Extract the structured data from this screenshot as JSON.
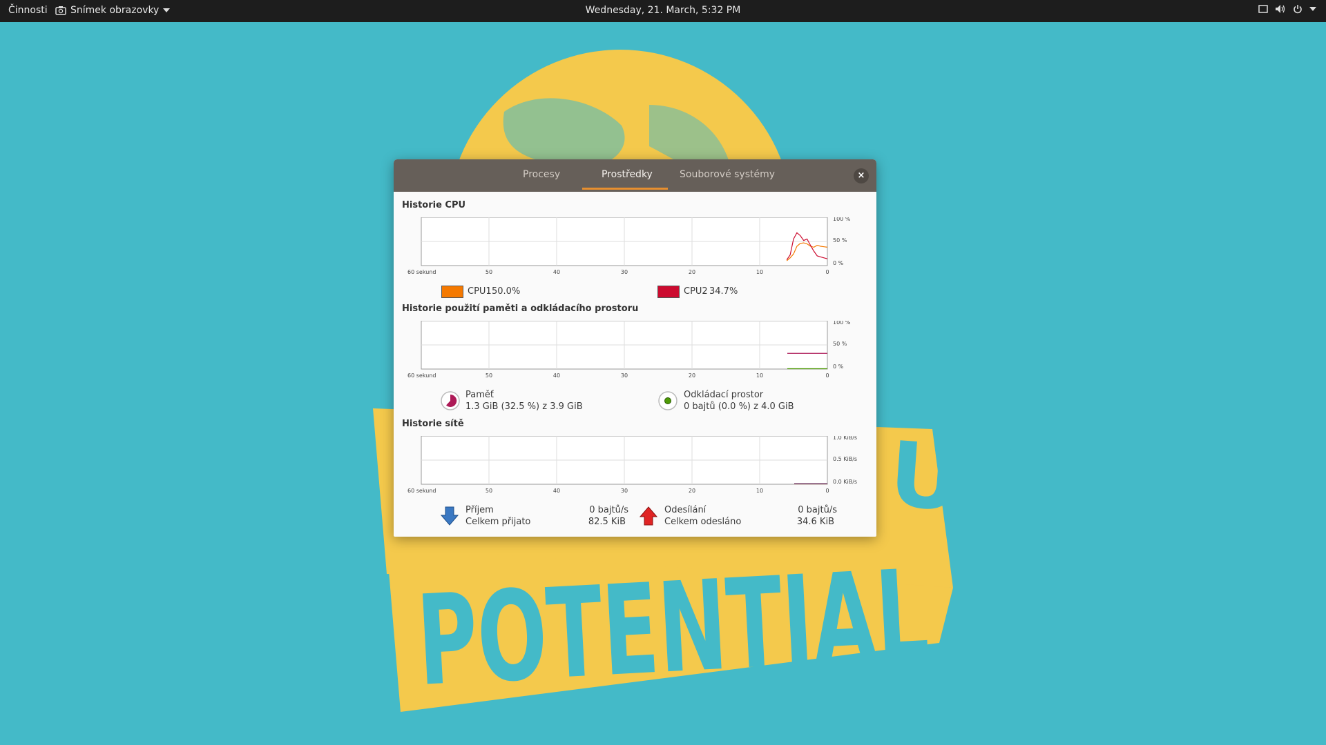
{
  "topbar": {
    "activities": "Činnosti",
    "app_name": "Snímek obrazovky",
    "clock": "Wednesday, 21. March,  5:32 PM",
    "tray_icons": [
      "screen-icon",
      "volume-icon",
      "power-icon",
      "tray-menu-arrow-icon"
    ]
  },
  "window": {
    "tabs": [
      {
        "label": "Procesy",
        "active": false
      },
      {
        "label": "Prostředky",
        "active": true
      },
      {
        "label": "Souborové systémy",
        "active": false
      }
    ],
    "close_label": "×",
    "cpu": {
      "title": "Historie CPU",
      "y_ticks": [
        "100 %",
        "50 %",
        "0 %"
      ],
      "x_ticks": [
        "60 sekund",
        "50",
        "40",
        "30",
        "20",
        "10",
        "0"
      ],
      "cpu1": {
        "label": "CPU1",
        "value": "50.0%",
        "color": "#f57900"
      },
      "cpu2": {
        "label": "CPU2",
        "value": "34.7%",
        "color": "#cc0b2f"
      },
      "cpu1_series_seconds": [
        6.0,
        5.5,
        5.0,
        4.5,
        4.0,
        3.5,
        3.0,
        2.5,
        2.0,
        1.5,
        1.0,
        0.5,
        0
      ],
      "cpu1_series_pct": [
        10,
        16,
        24,
        40,
        46,
        47,
        45,
        40,
        38,
        42,
        40,
        39,
        38
      ],
      "cpu2_series_seconds": [
        6.0,
        5.5,
        5.0,
        4.5,
        4.0,
        3.5,
        3.0,
        2.5,
        2.0,
        1.5,
        1.0,
        0.5,
        0
      ],
      "cpu2_series_pct": [
        12,
        22,
        55,
        68,
        62,
        52,
        55,
        42,
        30,
        20,
        18,
        16,
        14
      ]
    },
    "memory": {
      "title": "Historie použití paměti a odkládacího prostoru",
      "y_ticks": [
        "100 %",
        "50 %",
        "0 %"
      ],
      "x_ticks": [
        "60 sekund",
        "50",
        "40",
        "30",
        "20",
        "10",
        "0"
      ],
      "mem_label": "Paměť",
      "mem_value": "1.3 GiB (32.5 %) z 3.9 GiB",
      "mem_color": "#ad1a57",
      "mem_pct": 32.5,
      "swap_label": "Odkládací prostor",
      "swap_value": "0 bajtů (0.0 %) z 4.0 GiB",
      "swap_color": "#4e9a06",
      "swap_pct": 0.0
    },
    "network": {
      "title": "Historie sítě",
      "y_ticks": [
        "1.0 KiB/s",
        "0.5 KiB/s",
        "0.0 KiB/s"
      ],
      "x_ticks": [
        "60 sekund",
        "50",
        "40",
        "30",
        "20",
        "10",
        "0"
      ],
      "rx_label": "Příjem",
      "rx_total_label": "Celkem přijato",
      "rx_rate": "0 bajtů/s",
      "rx_total": "82.5 KiB",
      "tx_label": "Odesílání",
      "tx_total_label": "Celkem odesláno",
      "tx_rate": "0 bajtů/s",
      "tx_total": "34.6 KiB",
      "rx_color": "#3465a4",
      "tx_color": "#e02020"
    }
  },
  "wallpaper": {
    "words": [
      "POTENTIAL",
      "UR"
    ],
    "colors": {
      "sky": "#44bac8",
      "art": "#f4c94c"
    }
  }
}
